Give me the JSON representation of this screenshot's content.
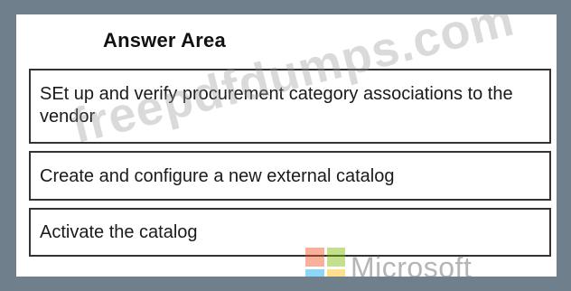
{
  "answer_area": {
    "title": "Answer Area",
    "steps": [
      {
        "label": "SEt up and verify procurement category associations to the vendor"
      },
      {
        "label": "Create and configure a new external catalog"
      },
      {
        "label": "Activate the catalog"
      }
    ]
  },
  "watermark": {
    "text": "freepdfdumps.com",
    "brand": "Microsoft"
  },
  "colors": {
    "frame": "#6f7f8c",
    "panel": "#ffffff",
    "border": "#333333",
    "text": "#1a1a1a"
  }
}
